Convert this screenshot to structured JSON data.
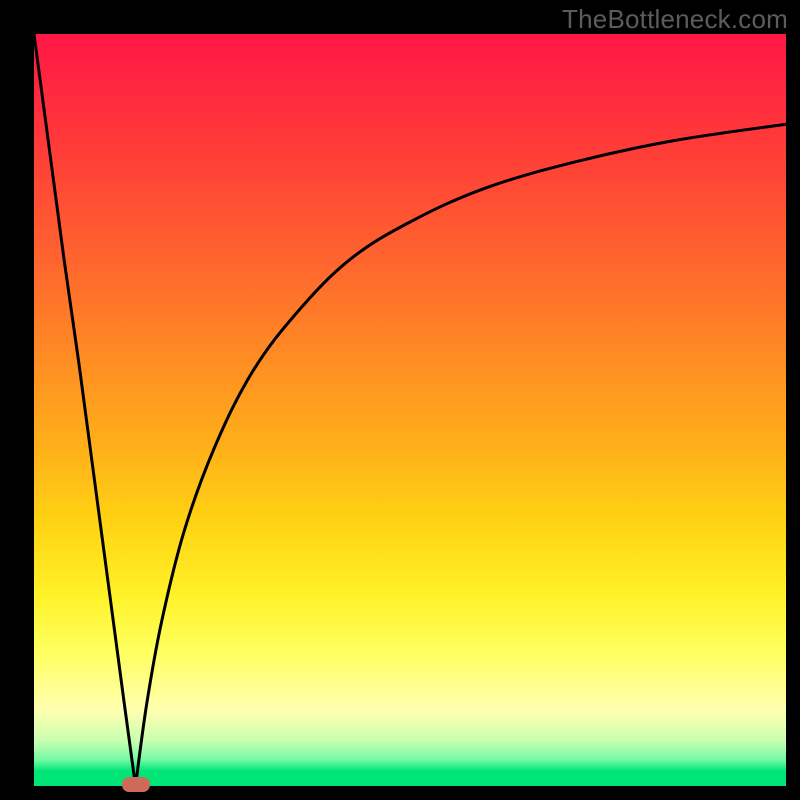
{
  "watermark": "TheBottleneck.com",
  "colors": {
    "frame": "#000000",
    "gradient_top": "#ff1744",
    "gradient_bottom": "#00e676",
    "curve_stroke": "#000000",
    "marker_fill": "#cc6a5c"
  },
  "chart_data": {
    "type": "line",
    "title": "",
    "xlabel": "",
    "ylabel": "",
    "xlim": [
      0,
      100
    ],
    "ylim": [
      0,
      100
    ],
    "grid": false,
    "legend": false,
    "note": "Axis values are estimated from relative position; no tick labels are shown in the source image.",
    "series": [
      {
        "name": "left-branch",
        "x": [
          0,
          2,
          4,
          6,
          8,
          10,
          12,
          13.5
        ],
        "y": [
          100,
          85,
          70,
          56,
          41,
          26,
          11,
          0
        ]
      },
      {
        "name": "right-branch",
        "x": [
          13.5,
          15,
          17,
          20,
          24,
          29,
          35,
          42,
          50,
          60,
          72,
          85,
          100
        ],
        "y": [
          0,
          11,
          22,
          34,
          45,
          55,
          63,
          70,
          75,
          79.5,
          83,
          85.8,
          88
        ]
      }
    ],
    "annotations": [
      {
        "type": "marker",
        "shape": "rounded-rect",
        "x": 13.5,
        "y": 0,
        "color": "#cc6a5c"
      }
    ]
  }
}
